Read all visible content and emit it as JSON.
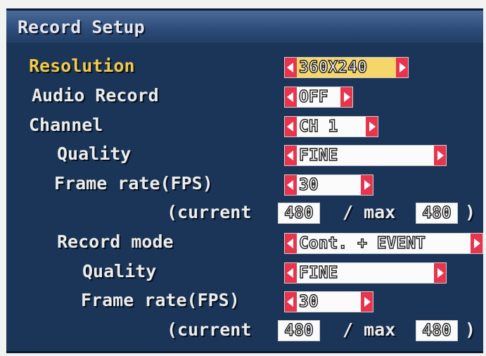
{
  "title": "Record Setup",
  "labels": {
    "resolution": "Resolution",
    "audio_record": "Audio Record",
    "channel": "Channel",
    "quality": "Quality",
    "frame_rate": "Frame rate(FPS)",
    "current_prefix": "(current",
    "max_sep": "/ max",
    "close_paren": ")",
    "record_mode": "Record mode"
  },
  "values": {
    "resolution": "360X240",
    "audio_record": "OFF",
    "channel": "CH 1",
    "quality": "FINE",
    "frame_rate": "30",
    "current1": "480",
    "max1": "480",
    "record_mode": "Cont. + EVENT",
    "rm_quality": "FINE",
    "rm_frame_rate": "30",
    "current2": "480",
    "max2": "480"
  },
  "colors": {
    "background": "#1a3557",
    "highlight_label": "#f2c94a",
    "arrow": "#e8344d"
  },
  "icons": {
    "left_arrow": "left-arrow-icon",
    "right_arrow": "right-arrow-icon"
  }
}
